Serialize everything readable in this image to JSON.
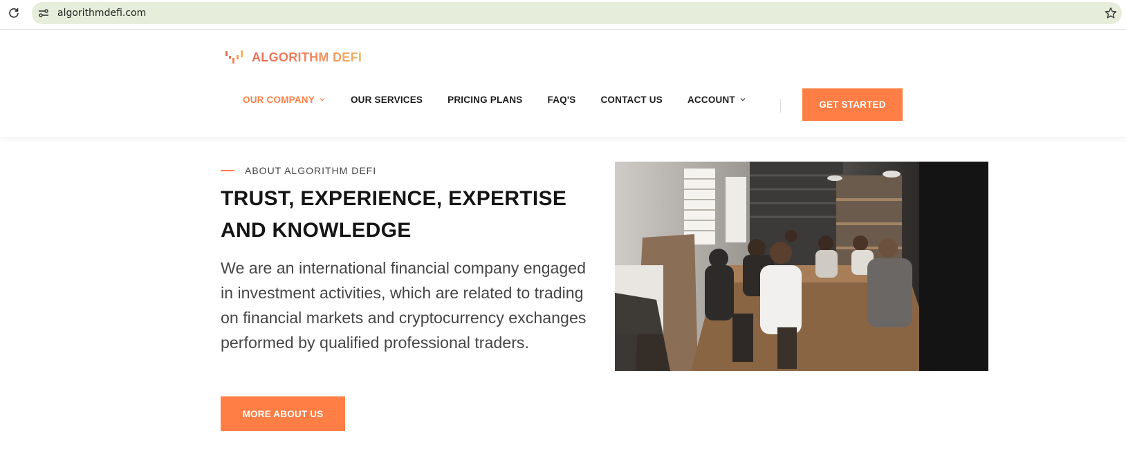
{
  "browser": {
    "url": "algorithmdefi.com",
    "icons": [
      "reload-icon",
      "site-info-icon",
      "bookmark-star-icon"
    ]
  },
  "header": {
    "logo_text": "ALGORITHM DEFI",
    "nav": [
      {
        "label": "OUR COMPANY",
        "active": true,
        "has_dropdown": true
      },
      {
        "label": "OUR SERVICES",
        "active": false,
        "has_dropdown": false
      },
      {
        "label": "PRICING PLANS",
        "active": false,
        "has_dropdown": false
      },
      {
        "label": "FAQ'S",
        "active": false,
        "has_dropdown": false
      },
      {
        "label": "CONTACT US",
        "active": false,
        "has_dropdown": false
      },
      {
        "label": "ACCOUNT",
        "active": false,
        "has_dropdown": true
      }
    ],
    "cta_label": "GET STARTED"
  },
  "about": {
    "eyebrow": "ABOUT ALGORITHM DEFI",
    "title_line1": "TRUST, EXPERIENCE, EXPERTISE",
    "title_line2": "AND KNOWLEDGE",
    "description": "We are an international financial company engaged in investment activities, which are related to trading on financial markets and cryptocurrency exchanges performed by qualified professional traders.",
    "button_label": "MORE ABOUT US"
  },
  "colors": {
    "accent": "#ff7e45",
    "url_bar": "#e6eedb",
    "text_dark": "#151515",
    "text_body": "#464646"
  }
}
